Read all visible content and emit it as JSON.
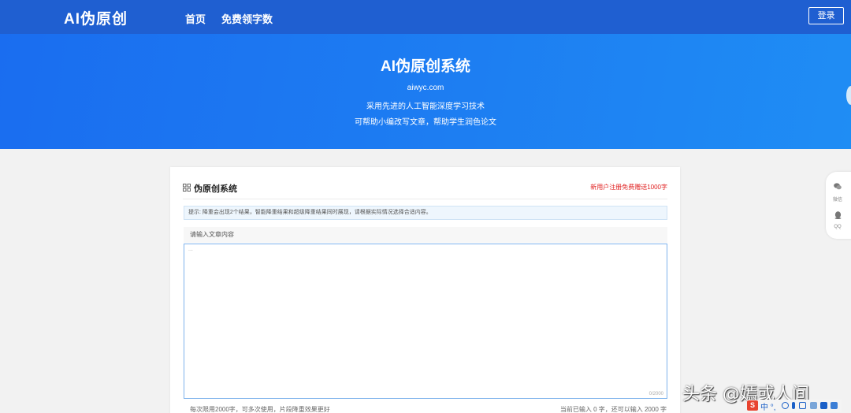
{
  "nav": {
    "logo": "AI伪原创",
    "links": [
      "首页",
      "免费领字数"
    ],
    "login_label": "登录"
  },
  "hero": {
    "title": "AI伪原创系统",
    "domain": "aiwyc.com",
    "line1": "采用先进的人工智能深度学习技术",
    "line2": "可帮助小编改写文章，帮助学生润色论文"
  },
  "card": {
    "title": "伪原创系统",
    "promo": "新用户注册免费赠送1000字",
    "tip": "提示: 降重会出现2个结果，智能降重结果和超级降重结果同时展现，请根据实际情况选择合适内容。",
    "input_label": "请输入文章内容",
    "placeholder": "...",
    "char_count": "0/2000",
    "footer_left": "每次限用2000字，可多次使用，片段降重效果更好",
    "footer_right": "当前已输入 0 字，还可以输入 2000 字"
  },
  "float": {
    "wechat_label": "微信",
    "qq_label": "QQ"
  },
  "watermark": "头条 @嫣或人间",
  "tray": {
    "ime_badge": "S",
    "ime_text": "中 °,"
  },
  "colors": {
    "nav_bg": "#1f5fd1",
    "hero_bg": "#1d7ef2",
    "promo_red": "#e02020",
    "textarea_border": "#7fb3ec"
  }
}
